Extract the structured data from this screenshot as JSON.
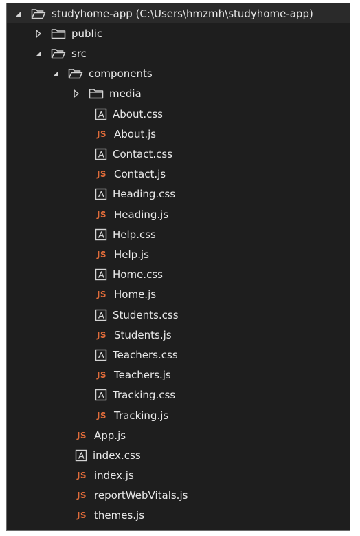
{
  "explorer": {
    "root": {
      "label": "studyhome-app (C:\\Users\\hmzmh\\studyhome-app)",
      "expanded": true
    },
    "public": {
      "label": "public",
      "expanded": false
    },
    "src": {
      "label": "src",
      "expanded": true
    },
    "components": {
      "label": "components",
      "expanded": true
    },
    "media": {
      "label": "media",
      "expanded": false
    },
    "component_files": [
      {
        "label": "About.css",
        "type": "css"
      },
      {
        "label": "About.js",
        "type": "js"
      },
      {
        "label": "Contact.css",
        "type": "css"
      },
      {
        "label": "Contact.js",
        "type": "js"
      },
      {
        "label": "Heading.css",
        "type": "css"
      },
      {
        "label": "Heading.js",
        "type": "js"
      },
      {
        "label": "Help.css",
        "type": "css"
      },
      {
        "label": "Help.js",
        "type": "js"
      },
      {
        "label": "Home.css",
        "type": "css"
      },
      {
        "label": "Home.js",
        "type": "js"
      },
      {
        "label": "Students.css",
        "type": "css"
      },
      {
        "label": "Students.js",
        "type": "js"
      },
      {
        "label": "Teachers.css",
        "type": "css"
      },
      {
        "label": "Teachers.js",
        "type": "js"
      },
      {
        "label": "Tracking.css",
        "type": "css"
      },
      {
        "label": "Tracking.js",
        "type": "js"
      }
    ],
    "src_files": [
      {
        "label": "App.js",
        "type": "js"
      },
      {
        "label": "index.css",
        "type": "css"
      },
      {
        "label": "index.js",
        "type": "js"
      },
      {
        "label": "reportWebVitals.js",
        "type": "js"
      },
      {
        "label": "themes.js",
        "type": "js"
      }
    ],
    "js_badge": "JS",
    "colors": {
      "background": "#1e1e1e",
      "root_row": "#2a2a2a",
      "text": "#e8e8e8",
      "js_badge": "#e06c3a",
      "icon_stroke": "#d4d4d4"
    }
  }
}
